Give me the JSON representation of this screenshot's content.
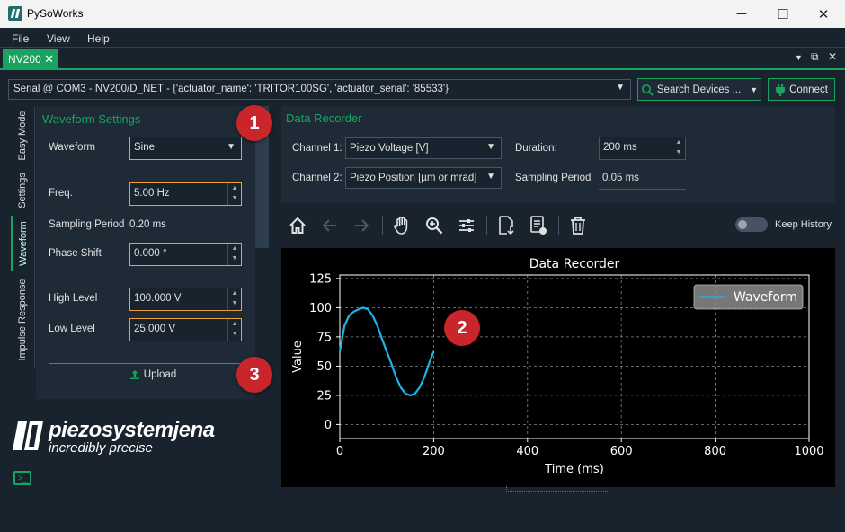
{
  "window": {
    "title": "PySoWorks",
    "controls": {
      "minimize": "─",
      "maximize": "☐",
      "close": "✕"
    }
  },
  "menubar": [
    "File",
    "View",
    "Help"
  ],
  "tab": {
    "label": "NV200",
    "close": "✕"
  },
  "device": {
    "connection": "Serial @ COM3 - NV200/D_NET - {'actuator_name': 'TRITOR100SG', 'actuator_serial': '85533'}",
    "search_label": "Search Devices ...",
    "connect_label": "Connect"
  },
  "side_tabs": [
    "Easy Mode",
    "Settings",
    "Waveform",
    "Impulse Response"
  ],
  "waveform": {
    "title": "Waveform Settings",
    "waveform_label": "Waveform",
    "waveform_value": "Sine",
    "freq_label": "Freq.",
    "freq_value": "5.00 Hz",
    "sampling_label": "Sampling Period",
    "sampling_value": "0.20 ms",
    "phase_label": "Phase Shift",
    "phase_value": "0.000 °",
    "high_label": "High Level",
    "high_value": "100.000 V",
    "low_label": "Low Level",
    "low_value": "25.000 V",
    "upload_label": "Upload"
  },
  "recorder": {
    "title": "Data Recorder",
    "ch1_label": "Channel 1:",
    "ch1_value": "Piezo Voltage [V]",
    "ch2_label": "Channel 2:",
    "ch2_value": "Piezo Position [µm or mrad]",
    "duration_label": "Duration:",
    "duration_value": "200 ms",
    "sampling_label": "Sampling Period",
    "sampling_value": "0.05 ms",
    "keep_history": "Keep History"
  },
  "badges": [
    "1",
    "2",
    "3"
  ],
  "logo": {
    "line1": "piezosystemjena",
    "line2": "incredibly precise"
  },
  "colors": {
    "accent": "#1aa260",
    "series": "#1fb3e8",
    "badge": "#c8262a",
    "field_border": "#f0a030"
  },
  "chart_data": {
    "type": "line",
    "title": "Data Recorder",
    "xlabel": "Time (ms)",
    "ylabel": "Value",
    "xlim": [
      0,
      1000
    ],
    "ylim": [
      -12,
      128
    ],
    "xticks": [
      0,
      200,
      400,
      600,
      800,
      1000
    ],
    "yticks": [
      0,
      25,
      50,
      75,
      100,
      125
    ],
    "grid": true,
    "legend_position": "top-right",
    "series": [
      {
        "name": "Waveform",
        "color": "#1fb3e8",
        "x": [
          0,
          10,
          20,
          30,
          40,
          50,
          60,
          70,
          80,
          90,
          100,
          110,
          120,
          130,
          140,
          150,
          160,
          170,
          180,
          190,
          200
        ],
        "y": [
          62.5,
          84.5,
          93.4,
          96.7,
          98.6,
          100,
          98.6,
          93.3,
          84.5,
          73.1,
          62.5,
          51.9,
          40.5,
          31.6,
          26.4,
          25,
          26.4,
          31.7,
          40.5,
          51.9,
          62.5
        ]
      }
    ]
  }
}
